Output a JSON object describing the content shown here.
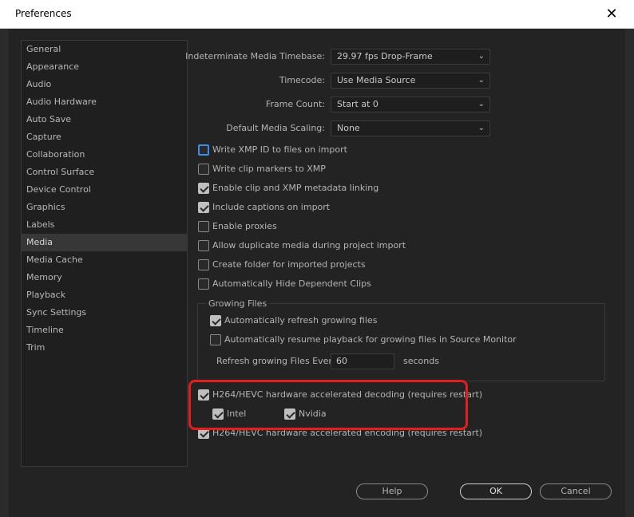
{
  "window": {
    "title": "Preferences",
    "close_glyph": "✕"
  },
  "sidebar": {
    "items": [
      {
        "label": "General"
      },
      {
        "label": "Appearance"
      },
      {
        "label": "Audio"
      },
      {
        "label": "Audio Hardware"
      },
      {
        "label": "Auto Save"
      },
      {
        "label": "Capture"
      },
      {
        "label": "Collaboration"
      },
      {
        "label": "Control Surface"
      },
      {
        "label": "Device Control"
      },
      {
        "label": "Graphics"
      },
      {
        "label": "Labels"
      },
      {
        "label": "Media",
        "active": true
      },
      {
        "label": "Media Cache"
      },
      {
        "label": "Memory"
      },
      {
        "label": "Playback"
      },
      {
        "label": "Sync Settings"
      },
      {
        "label": "Timeline"
      },
      {
        "label": "Trim"
      }
    ]
  },
  "media": {
    "fields": {
      "timebase": {
        "label": "Indeterminate Media Timebase:",
        "value": "29.97 fps Drop-Frame"
      },
      "timecode": {
        "label": "Timecode:",
        "value": "Use Media Source"
      },
      "frame_count": {
        "label": "Frame Count:",
        "value": "Start at 0"
      },
      "scaling": {
        "label": "Default Media Scaling:",
        "value": "None"
      }
    },
    "checkboxes": {
      "write_xmp": {
        "label": "Write XMP ID to files on import",
        "checked": false
      },
      "write_clip_markers": {
        "label": "Write clip markers to XMP",
        "checked": false
      },
      "enable_linking": {
        "label": "Enable clip and XMP metadata linking",
        "checked": true
      },
      "include_captions": {
        "label": "Include captions on import",
        "checked": true
      },
      "enable_proxies": {
        "label": "Enable proxies",
        "checked": false
      },
      "allow_duplicate": {
        "label": "Allow duplicate media during project import",
        "checked": false
      },
      "create_folder": {
        "label": "Create folder for imported projects",
        "checked": false
      },
      "auto_hide": {
        "label": "Automatically Hide Dependent Clips",
        "checked": false
      }
    },
    "growing_files": {
      "title": "Growing Files",
      "auto_refresh": {
        "label": "Automatically refresh growing files",
        "checked": true
      },
      "auto_resume": {
        "label": "Automatically resume playback for growing files in Source Monitor",
        "checked": false
      },
      "refresh_label": "Refresh growing Files Every",
      "refresh_value": "60",
      "refresh_unit": "seconds"
    },
    "hw_decoding": {
      "label": "H264/HEVC hardware accelerated decoding (requires restart)",
      "checked": true
    },
    "intel": {
      "label": "Intel",
      "checked": true
    },
    "nvidia": {
      "label": "Nvidia",
      "checked": true
    },
    "hw_encoding": {
      "label": "H264/HEVC hardware accelerated encoding (requires restart)",
      "checked": true
    }
  },
  "buttons": {
    "help": "Help",
    "ok": "OK",
    "cancel": "Cancel"
  },
  "colors": {
    "highlight": "#e41e1e",
    "focus": "#3b8ee8"
  }
}
